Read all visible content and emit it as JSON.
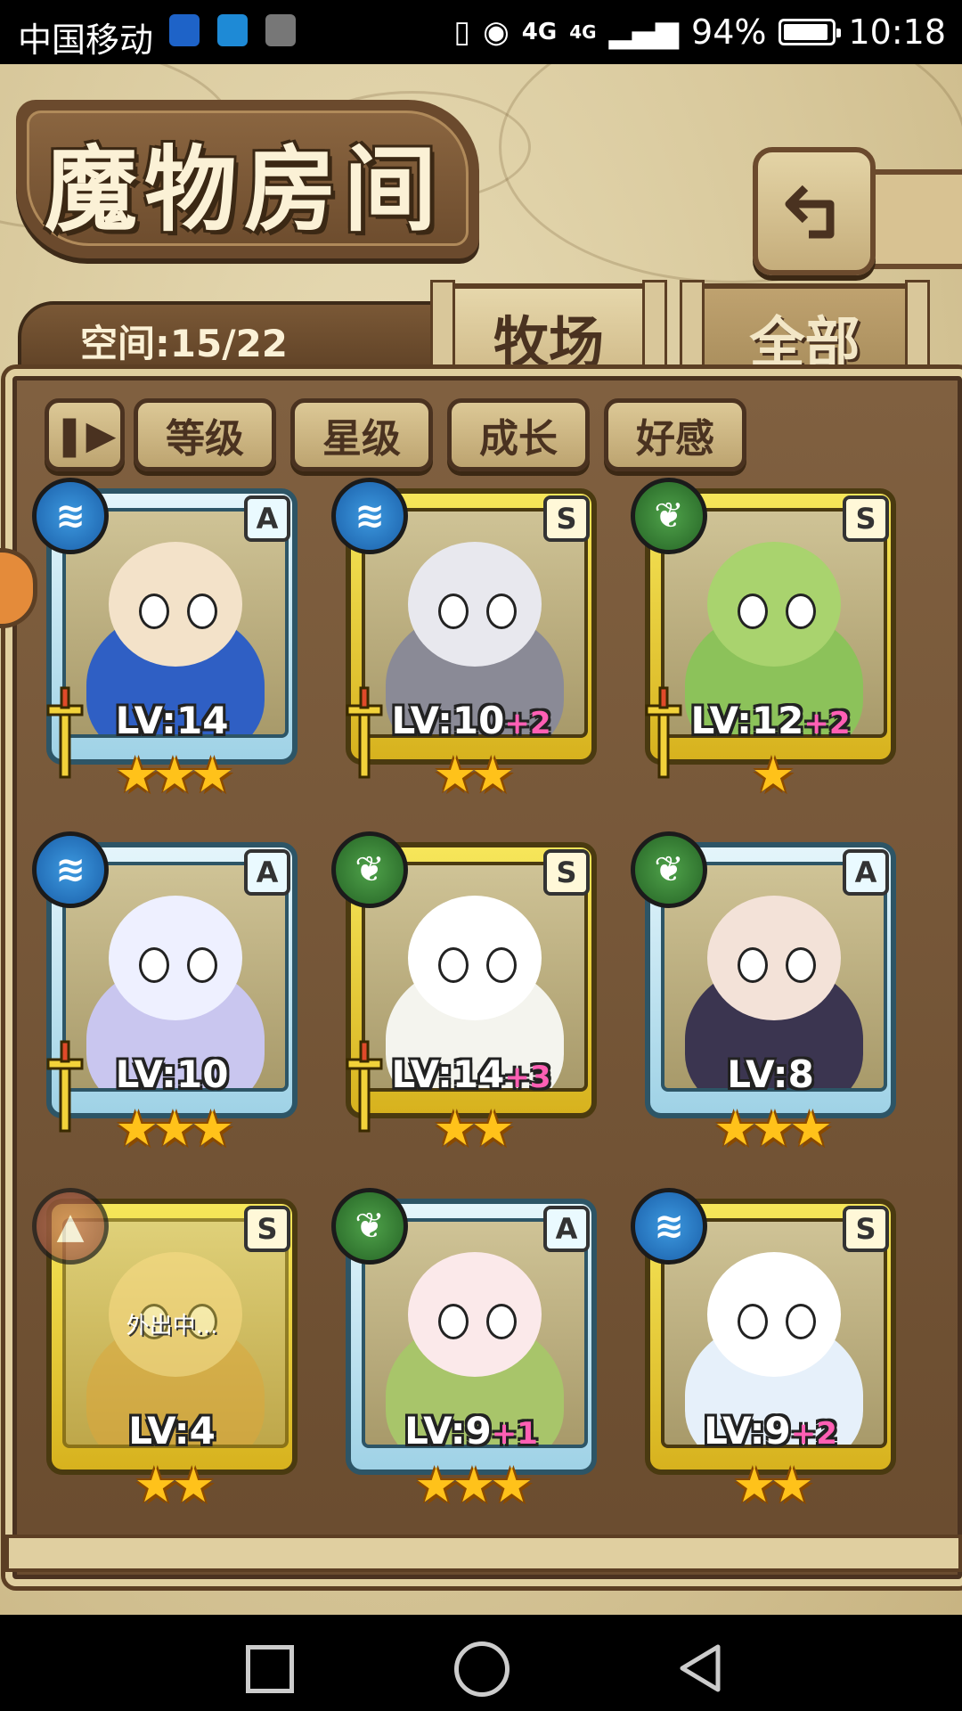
{
  "status_bar": {
    "carrier": "中国移动",
    "network_label": "4G",
    "network_label2": "4G",
    "battery": "94%",
    "battery_level": 0.94,
    "time": "10:18"
  },
  "header": {
    "title": "魔物房间"
  },
  "space": {
    "label": "空间:15/22"
  },
  "tabs": [
    {
      "label": "牧场",
      "active": true
    },
    {
      "label": "全部",
      "active": false
    }
  ],
  "sort_buttons": [
    {
      "label": "等级"
    },
    {
      "label": "星级"
    },
    {
      "label": "成长"
    },
    {
      "label": "好感"
    }
  ],
  "monsters": [
    {
      "rank": "A",
      "element": "water",
      "level": "LV:14",
      "plus": "",
      "stars": 3,
      "frame": "blue",
      "equipped": true,
      "status": ""
    },
    {
      "rank": "S",
      "element": "water",
      "level": "LV:10",
      "plus": "+2",
      "stars": 2,
      "frame": "gold",
      "equipped": true,
      "status": ""
    },
    {
      "rank": "S",
      "element": "wood",
      "level": "LV:12",
      "plus": "+2",
      "stars": 1,
      "frame": "gold",
      "equipped": true,
      "status": ""
    },
    {
      "rank": "A",
      "element": "water",
      "level": "LV:10",
      "plus": "",
      "stars": 3,
      "frame": "blue",
      "equipped": true,
      "status": ""
    },
    {
      "rank": "S",
      "element": "wood",
      "level": "LV:14",
      "plus": "+3",
      "stars": 2,
      "frame": "gold",
      "equipped": true,
      "status": ""
    },
    {
      "rank": "A",
      "element": "wood",
      "level": "LV:8",
      "plus": "",
      "stars": 3,
      "frame": "blue",
      "equipped": false,
      "status": ""
    },
    {
      "rank": "S",
      "element": "earth",
      "level": "LV:4",
      "plus": "",
      "stars": 2,
      "frame": "gold",
      "equipped": false,
      "status": "外出中..."
    },
    {
      "rank": "A",
      "element": "wood",
      "level": "LV:9",
      "plus": "+1",
      "stars": 3,
      "frame": "blue",
      "equipped": false,
      "status": ""
    },
    {
      "rank": "S",
      "element": "water",
      "level": "LV:9",
      "plus": "+2",
      "stars": 2,
      "frame": "gold",
      "equipped": false,
      "status": ""
    }
  ],
  "colors": {
    "gold_frame": "#f6e65a",
    "blue_frame": "#9fd2e6",
    "plus_text": "#ff5fb4",
    "star": "#ffc21a"
  }
}
